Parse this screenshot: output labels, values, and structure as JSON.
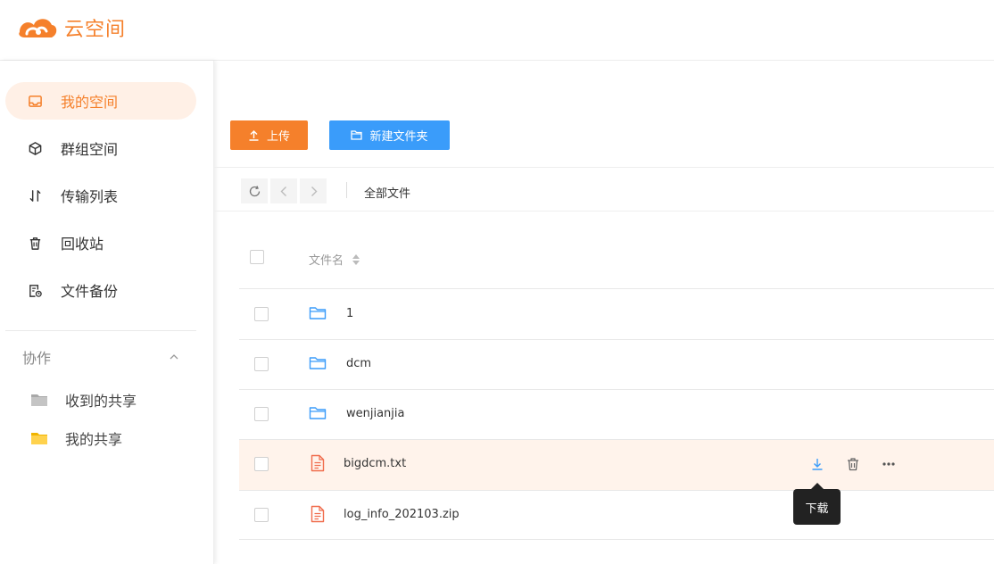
{
  "app": {
    "title": "云空间",
    "logo_icon": "cloud-swirl-logo",
    "brand_color": "#f5802b",
    "accent_blue": "#3a9cfa"
  },
  "sidebar": {
    "items": [
      {
        "label": "我的空间",
        "icon": "inbox-icon",
        "active": true
      },
      {
        "label": "群组空间",
        "icon": "cube-icon",
        "active": false
      },
      {
        "label": "传输列表",
        "icon": "transfer-icon",
        "active": false
      },
      {
        "label": "回收站",
        "icon": "trash-icon",
        "active": false
      },
      {
        "label": "文件备份",
        "icon": "backup-icon",
        "active": false
      }
    ],
    "section": {
      "label": "协作",
      "expanded": true
    },
    "sub_items": [
      {
        "label": "收到的共享",
        "icon": "folder-gray-icon"
      },
      {
        "label": "我的共享",
        "icon": "folder-yellow-icon"
      }
    ]
  },
  "toolbar": {
    "upload_label": "上传",
    "new_folder_label": "新建文件夹"
  },
  "breadcrumb": {
    "current": "全部文件"
  },
  "table": {
    "header_name": "文件名",
    "rows": [
      {
        "name": "1",
        "type": "folder"
      },
      {
        "name": "dcm",
        "type": "folder"
      },
      {
        "name": "wenjianjia",
        "type": "folder"
      },
      {
        "name": "bigdcm.txt",
        "type": "file",
        "hovered": true
      },
      {
        "name": "log_info_202103.zip",
        "type": "file"
      }
    ]
  },
  "tooltip": {
    "text": "下载"
  }
}
